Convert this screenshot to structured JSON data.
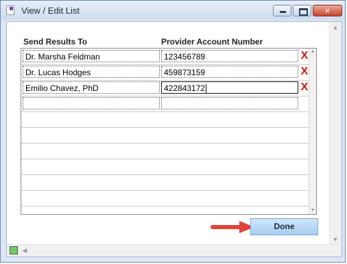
{
  "window": {
    "title": "View / Edit List",
    "close_glyph": "×"
  },
  "columns": {
    "send_to": "Send Results To",
    "account": "Provider Account Number"
  },
  "rows": [
    {
      "name": "Dr. Marsha Feldman",
      "account": "123456789",
      "delete": "X"
    },
    {
      "name": "Dr. Lucas Hodges",
      "account": "459873159",
      "delete": "X"
    },
    {
      "name": "Emilio Chavez, PhD",
      "account": "422843172",
      "delete": "X"
    },
    {
      "name": "",
      "account": ""
    }
  ],
  "done_label": "Done",
  "icons": {
    "window": "list-icon",
    "lock": "lock-icon",
    "delete": "delete-x-icon",
    "annotation": "red-arrow-icon"
  },
  "colors": {
    "delete": "#d81010",
    "done_button": "#a7cdf2",
    "arrow": "#e0443a"
  }
}
